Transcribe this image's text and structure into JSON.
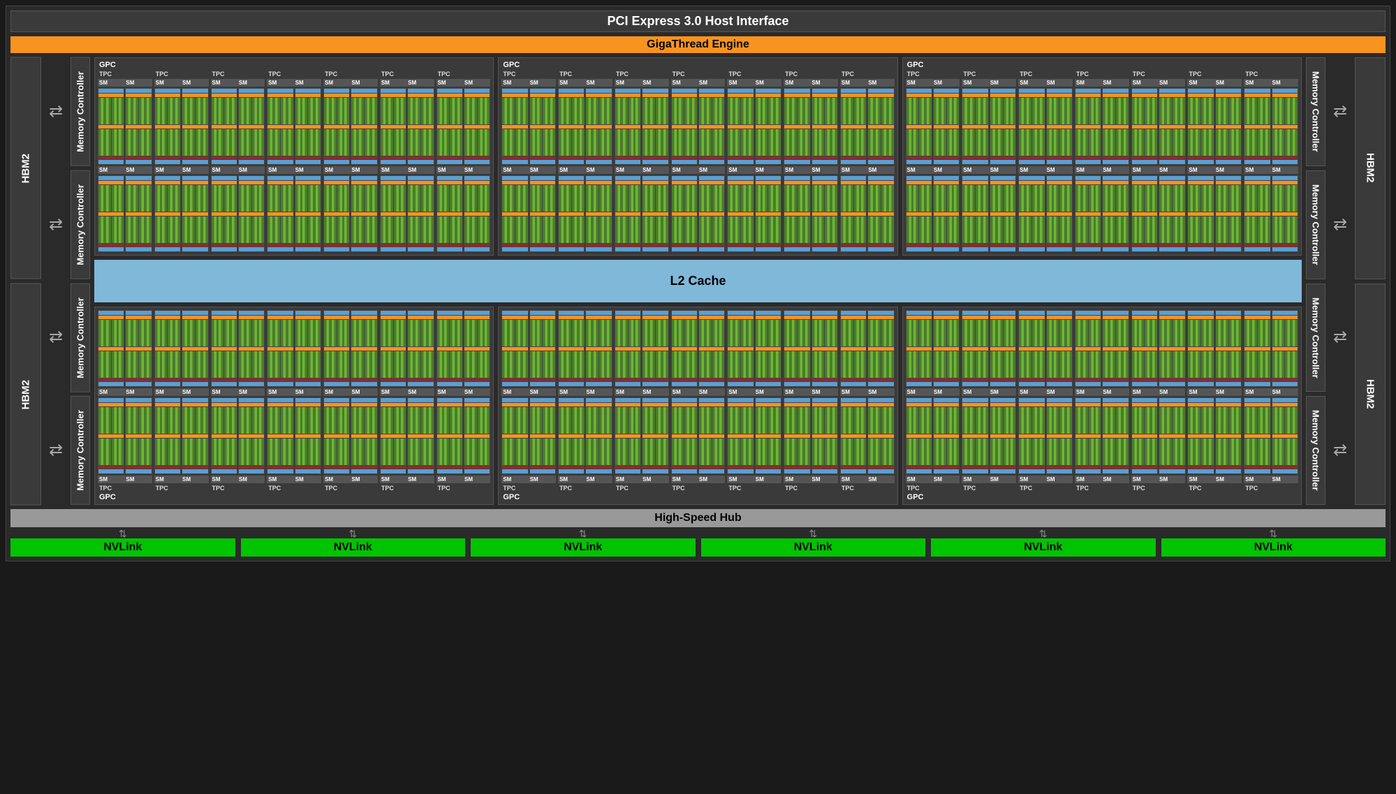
{
  "pci_label": "PCI Express 3.0 Host Interface",
  "gigathread_label": "GigaThread Engine",
  "hbm2_label": "HBM2",
  "memctrl_label": "Memory Controller",
  "gpc_label": "GPC",
  "tpc_label": "TPC",
  "sm_label": "SM",
  "l2cache_label": "L2 Cache",
  "hub_label": "High-Speed Hub",
  "nvlink_label": "NVLink",
  "layout": {
    "gpc_rows": 2,
    "gpcs_per_row": 3,
    "tpcs_per_gpc": 7,
    "sm_rows_per_gpc": 2,
    "sms_per_tpc": 2,
    "hbm2_per_side": 2,
    "memctrl_per_side": 4,
    "nvlink_count": 6
  }
}
